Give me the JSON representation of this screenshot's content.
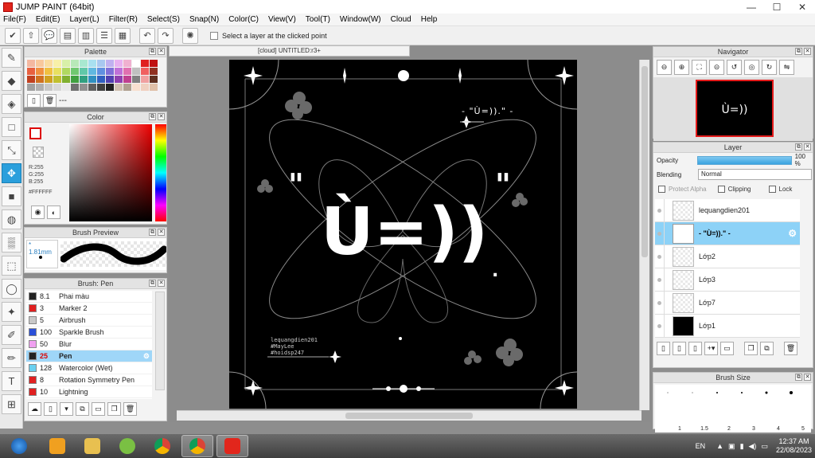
{
  "window": {
    "title": "JUMP PAINT (64bit)",
    "minimize": "—",
    "maximize": "☐",
    "close": "✕"
  },
  "menu": [
    "File(F)",
    "Edit(E)",
    "Layer(L)",
    "Filter(R)",
    "Select(S)",
    "Snap(N)",
    "Color(C)",
    "View(V)",
    "Tool(T)",
    "Window(W)",
    "Cloud",
    "Help"
  ],
  "toolbar": {
    "select_layer_label": "Select a layer at the clicked point"
  },
  "palette": {
    "title": "Palette",
    "footer_label": "---",
    "colors": [
      "#f4b8a0",
      "#f8c89c",
      "#fadca0",
      "#f8f0a8",
      "#d8f0a8",
      "#b8e8b8",
      "#a8e8d0",
      "#a8e0f0",
      "#a8c8f0",
      "#c0b0f0",
      "#e8b0f0",
      "#f0b0d0",
      "#ffffff",
      "#e02020",
      "#c01010",
      "#e86040",
      "#f09040",
      "#f0c040",
      "#e8e060",
      "#b0d860",
      "#70c870",
      "#60c8a8",
      "#60b8e0",
      "#6090e0",
      "#8070d8",
      "#c070d8",
      "#e070b0",
      "#c0c0c0",
      "#f06060",
      "#903020",
      "#c04020",
      "#d07020",
      "#d0a020",
      "#c0c030",
      "#80b030",
      "#40a040",
      "#30a080",
      "#3090c0",
      "#3060c0",
      "#5040b0",
      "#9040b0",
      "#c04090",
      "#808080",
      "#f0a0a0",
      "#603020",
      "#a0a0a0",
      "#b0b0b0",
      "#c8c8c8",
      "#d8d8d8",
      "#e8e8e8",
      "#707070",
      "#909090",
      "#606060",
      "#404040",
      "#202020",
      "#d0c0b0",
      "#b0a090",
      "#f8e0d0",
      "#f0d0c0",
      "#e0c0a8"
    ]
  },
  "color": {
    "title": "Color",
    "r": "R:255",
    "g": "G:255",
    "b": "B:255",
    "hex": "#FFFFFF"
  },
  "brush_preview": {
    "title": "Brush Preview",
    "size": "* 1.81mm"
  },
  "brushes": {
    "title": "Brush: Pen",
    "items": [
      {
        "num": "8.1",
        "name": "Phai màu",
        "color": "#222222"
      },
      {
        "num": "3",
        "name": "Marker 2",
        "color": "#e02020"
      },
      {
        "num": "5",
        "name": "Airbrush",
        "color": "#c8c8c8"
      },
      {
        "num": "100",
        "name": "Sparkle Brush",
        "color": "#2a4fd8"
      },
      {
        "num": "50",
        "name": "Blur",
        "color": "#f0a0f0"
      },
      {
        "num": "25",
        "name": "Pen",
        "color": "#222222",
        "selected": true
      },
      {
        "num": "128",
        "name": "Watercolor (Wet)",
        "color": "#6ad0f0"
      },
      {
        "num": "8",
        "name": "Rotation Symmetry Pen",
        "color": "#e02020"
      },
      {
        "num": "10",
        "name": "Lightning",
        "color": "#e02020"
      }
    ]
  },
  "document": {
    "tab_title": "[cloud] UNTITLED:r3+"
  },
  "artwork": {
    "top_line": "- \"Ù=)).\" -",
    "quote_left": "\"",
    "quote_right": "\"",
    "main_text": "Ù=))",
    "dot": ".",
    "credit_1": "lequangdien201",
    "credit_2": "#MayLee",
    "credit_3": "#hoidsp247"
  },
  "navigator": {
    "title": "Navigator",
    "thumb_text": "Ù=))"
  },
  "layer_panel": {
    "title": "Layer",
    "opacity_label": "Opacity",
    "opacity_value": "100 %",
    "opacity_fraction": 1.0,
    "blending_label": "Blending",
    "blending_value": "Normal",
    "protect_alpha": "Protect Alpha",
    "clipping": "Clipping",
    "lock": "Lock",
    "layers": [
      {
        "name": "lequangdien201",
        "selected": false,
        "black": false
      },
      {
        "name": "- \"Ù=)).\" -",
        "selected": true,
        "black": false
      },
      {
        "name": "Lớp2",
        "selected": false,
        "black": false
      },
      {
        "name": "Lớp3",
        "selected": false,
        "black": false
      },
      {
        "name": "Lớp7",
        "selected": false,
        "black": false
      },
      {
        "name": "Lớp1",
        "selected": false,
        "black": true
      }
    ]
  },
  "brush_size": {
    "title": "Brush Size",
    "labels": [
      "1",
      "1.5",
      "2",
      "3",
      "4",
      "5"
    ]
  },
  "taskbar": {
    "language": "EN",
    "time": "12:37 AM",
    "date": "22/08/2023"
  }
}
